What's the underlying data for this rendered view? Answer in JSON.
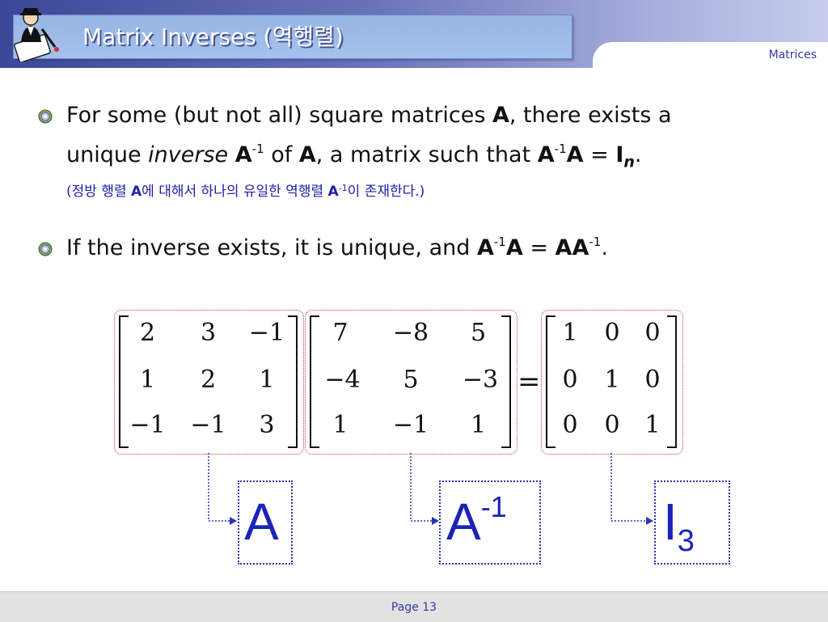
{
  "header": {
    "title": "Matrix Inverses (역행렬)",
    "section_label": "Matrices"
  },
  "bullets": [
    {
      "line1_pre": "For some (but not all) square matrices ",
      "line1_bold": "A",
      "line1_post": ", there exists a",
      "line2_pre": "unique ",
      "line2_italic": "inverse",
      "line2_space": " ",
      "line2_bold1": "A",
      "line2_sup1": "-1",
      "line2_mid": " of ",
      "line2_bold2": "A",
      "line2_mid2": ", a matrix such that ",
      "line2_bold3": "A",
      "line2_sup2": "-1",
      "line2_bold4": "A",
      "line2_eq": " = ",
      "line2_bold5": "I",
      "line2_sub": "n",
      "line2_end": ".",
      "korean_pre": "(정방 행렬 ",
      "korean_bold1": "A",
      "korean_mid": "에 대해서 하나의 유일한 역행렬 ",
      "korean_bold2": "A",
      "korean_sup": "-1",
      "korean_post": "이 존재한다.)"
    },
    {
      "pre": "If the inverse exists, it is unique, and ",
      "bold1": "A",
      "sup1": "-1",
      "bold2": "A",
      "eq": " = ",
      "bold3": "AA",
      "sup2": "-1",
      "end": "."
    }
  ],
  "matrices": {
    "A": [
      [
        "2",
        "3",
        "−1"
      ],
      [
        "1",
        "2",
        "1"
      ],
      [
        "−1",
        "−1",
        "3"
      ]
    ],
    "A_inv": [
      [
        "7",
        "−8",
        "5"
      ],
      [
        "−4",
        "5",
        "−3"
      ],
      [
        "1",
        "−1",
        "1"
      ]
    ],
    "I": [
      [
        "1",
        "0",
        "0"
      ],
      [
        "0",
        "1",
        "0"
      ],
      [
        "0",
        "0",
        "1"
      ]
    ],
    "equals": "="
  },
  "labels": {
    "A": "A",
    "A_inv_base": "A",
    "A_inv_sup": "-1",
    "I_base": "I",
    "I_sub": "3"
  },
  "footer": {
    "page": "Page 13"
  },
  "colors": {
    "header_dark": "#3b4798",
    "title_box": "#a5c1ec",
    "label_blue": "#1c23b8",
    "frame_red": "#d23b3b",
    "text_blue": "#2020a8"
  }
}
